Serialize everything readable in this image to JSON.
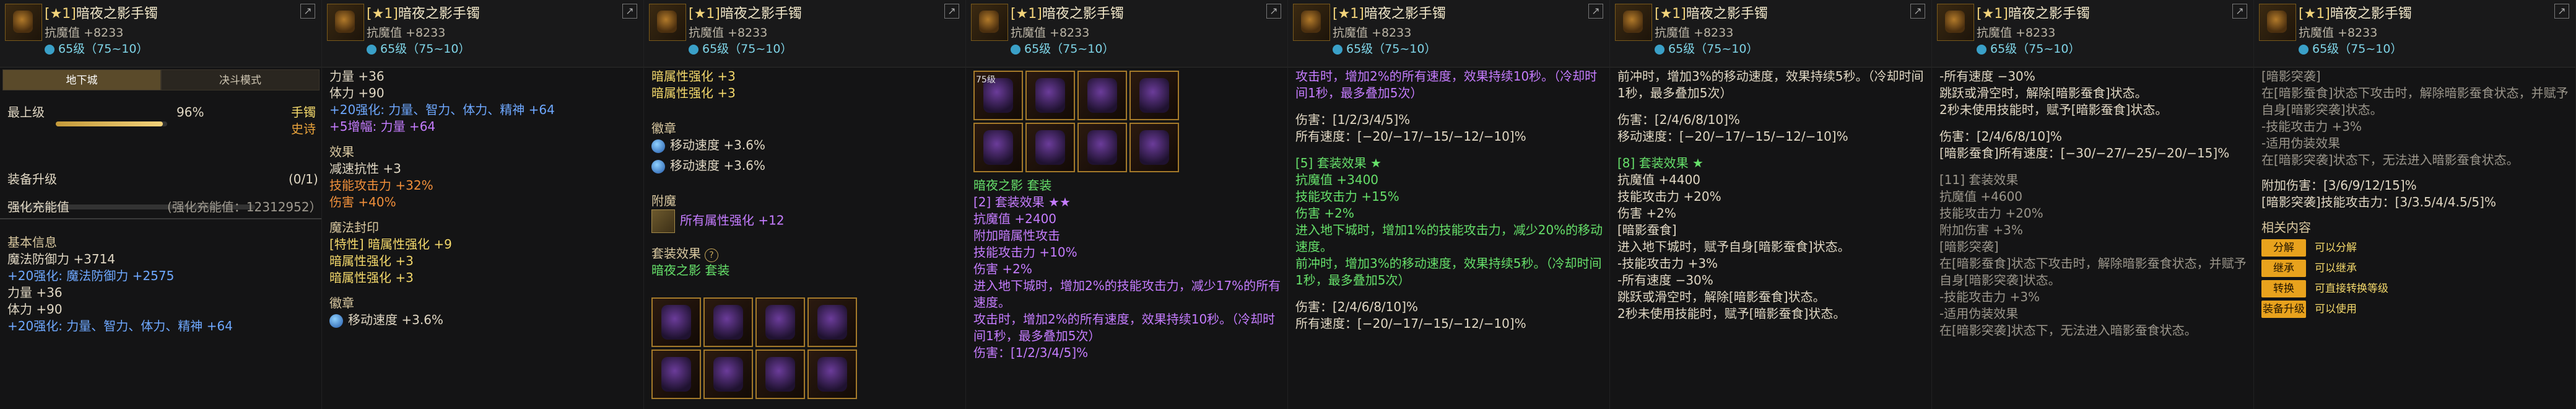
{
  "item": {
    "tag": "[★1]",
    "name": "暗夜之影手镯",
    "resist": "抗魔值 +8233",
    "level_badge": "65级（75~10）"
  },
  "p1": {
    "tabs": [
      "地下城",
      "决斗模式"
    ],
    "max_label": "最上级",
    "max_pct": "96%",
    "max_fill": 0.96,
    "right_top": "手镯",
    "right_sub": "史诗",
    "upgrade_label": "装备升级",
    "upgrade_count": "(0/1)",
    "charge_label": "强化充能值",
    "charge_value": "(强化充能值：12312952）",
    "basic_label": "基本信息",
    "basic": [
      "魔法防御力 +3714",
      "+20强化: 魔法防御力 +2575",
      "力量 +36",
      "体力 +90",
      "+20强化: 力量、智力、体力、精神 +64"
    ]
  },
  "p2": {
    "lines": [
      "力量 +36",
      "体力 +90",
      "+20强化: 力量、智力、体力、精神 +64",
      "+5增幅: 力量 +64"
    ],
    "effect_label": "效果",
    "effects": [
      "减速抗性 +3",
      "技能攻击力 +32%",
      "伤害 +40%"
    ],
    "seal_label": "魔法封印",
    "seal": [
      "[特性] 暗属性强化 +9",
      "暗属性强化 +3",
      "暗属性强化 +3"
    ],
    "badge_label": "徽章",
    "badge": "移动速度 +3.6%"
  },
  "p3": {
    "top": [
      "暗属性强化 +3",
      "暗属性强化 +3"
    ],
    "badge_label": "徽章",
    "badges": [
      "移动速度 +3.6%",
      "移动速度 +3.6%"
    ],
    "enchant_label": "附魔",
    "enchant": "所有属性强化 +12",
    "set_label": "套装效果",
    "set_name": "暗夜之影 套装"
  },
  "p4": {
    "tiles": [
      "75级",
      "",
      "",
      "",
      "",
      "",
      "",
      "",
      "",
      "",
      "",
      ""
    ],
    "set_name": "暗夜之影 套装",
    "set2": "[2] 套装效果 ★★",
    "lines": [
      "抗魔值 +2400",
      "附加暗属性攻击",
      "技能攻击力 +10%",
      "伤害 +2%",
      "进入地下城时，增加2%的技能攻击力，减少17%的所有速度。",
      "攻击时，增加2%的所有速度，效果持续10秒。（冷却时间1秒，最多叠加5次）",
      "伤害：[1/2/3/4/5]%"
    ]
  },
  "p5": {
    "top": [
      "攻击时，增加2%的所有速度，效果持续10秒。（冷却时间1秒，最多叠加5次）"
    ],
    "dmg": "伤害：[1/2/3/4/5]%",
    "spd": "所有速度：[−20/−17/−15/−12/−10]%",
    "set5": "[5] 套装效果 ★",
    "lines": [
      "抗魔值 +3400",
      "技能攻击力 +15%",
      "伤害 +2%",
      "进入地下城时，增加1%的技能攻击力，减少20%的移动速度。",
      "前冲时，增加3%的移动速度，效果持续5秒。（冷却时间1秒，最多叠加5次）",
      "伤害：[2/4/6/8/10]%",
      "所有速度：[−20/−17/−15/−12/−10]%"
    ]
  },
  "p6": {
    "top": [
      "前冲时，增加3%的移动速度，效果持续5秒。（冷却时间1秒，最多叠加5次）"
    ],
    "dmg": "伤害：[2/4/6/8/10]%",
    "spd": "移动速度：[−20/−17/−15/−12/−10]%",
    "set8": "[8] 套装效果 ★",
    "lines": [
      "抗魔值 +4400",
      "技能攻击力 +20%",
      "伤害 +2%",
      "[暗影蚕食]",
      "进入地下城时，赋予自身[暗影蚕食]状态。",
      "-技能攻击力 +3%",
      "-所有速度 −30%",
      "跳跃或滑空时，解除[暗影蚕食]状态。",
      "2秒未使用技能时，赋予[暗影蚕食]状态。"
    ]
  },
  "p7": {
    "top": [
      "-所有速度 −30%",
      "跳跃或滑空时，解除[暗影蚕食]状态。",
      "2秒未使用技能时，赋予[暗影蚕食]状态。"
    ],
    "dmg": "伤害：[2/4/6/8/10]%",
    "shadow": "[暗影蚕食]所有速度：[−30/−27/−25/−20/−15]%",
    "set11": "[11] 套装效果",
    "lines": [
      "抗魔值 +4600",
      "技能攻击力 +20%",
      "附加伤害 +3%",
      "[暗影突袭]",
      "在[暗影蚕食]状态下攻击时，解除暗影蚕食状态，并赋予自身[暗影突袭]状态。",
      "-技能攻击力 +3%",
      "-适用伪装效果",
      "在[暗影突袭]状态下，无法进入暗影蚕食状态。"
    ]
  },
  "p8": {
    "top": [
      "[暗影突袭]",
      "在[暗影蚕食]状态下攻击时，解除暗影蚕食状态，并赋予自身[暗影突袭]状态。",
      "-技能攻击力 +3%",
      "-适用伪装效果",
      "在[暗影突袭]状态下，无法进入暗影蚕食状态。"
    ],
    "add": "附加伤害：[3/6/9/12/15]%",
    "atk": "[暗影突袭]技能攻击力：[3/3.5/4/4.5/5]%",
    "related": "相关内容",
    "actions": [
      {
        "label": "分解",
        "note": "可以分解"
      },
      {
        "label": "继承",
        "note": "可以继承"
      },
      {
        "label": "转换",
        "note": "可直接转换等级"
      },
      {
        "label": "装备升级",
        "note": "可以使用"
      }
    ]
  }
}
